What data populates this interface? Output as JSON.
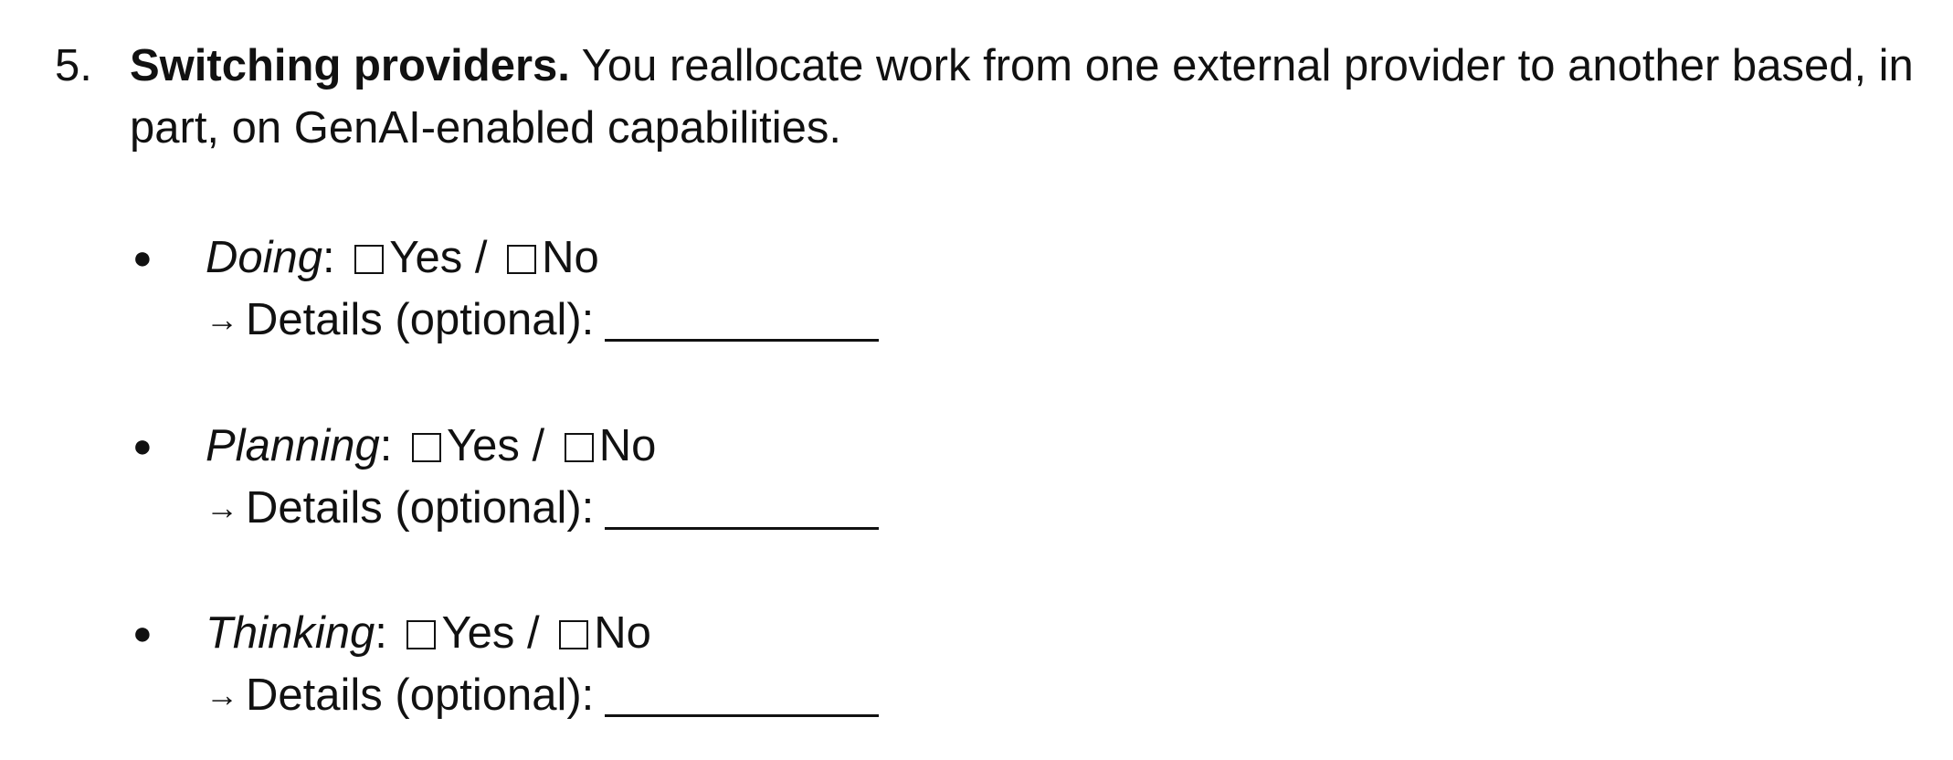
{
  "question": {
    "number": "5.",
    "title": "Switching providers.",
    "body": " You reallocate work from one external provider to another based, in part, on GenAI-enabled capabilities."
  },
  "items": [
    {
      "label": "Doing",
      "colon": ":",
      "yes_label": "Yes",
      "separator": "/",
      "no_label": "No",
      "arrow": "→",
      "details_label": "Details (optional):"
    },
    {
      "label": "Planning",
      "colon": ":",
      "yes_label": "Yes",
      "separator": "/",
      "no_label": "No",
      "arrow": "→",
      "details_label": "Details (optional):"
    },
    {
      "label": "Thinking",
      "colon": ":",
      "yes_label": "Yes",
      "separator": "/",
      "no_label": "No",
      "arrow": "→",
      "details_label": "Details (optional):"
    }
  ],
  "bullet_glyph": "●"
}
